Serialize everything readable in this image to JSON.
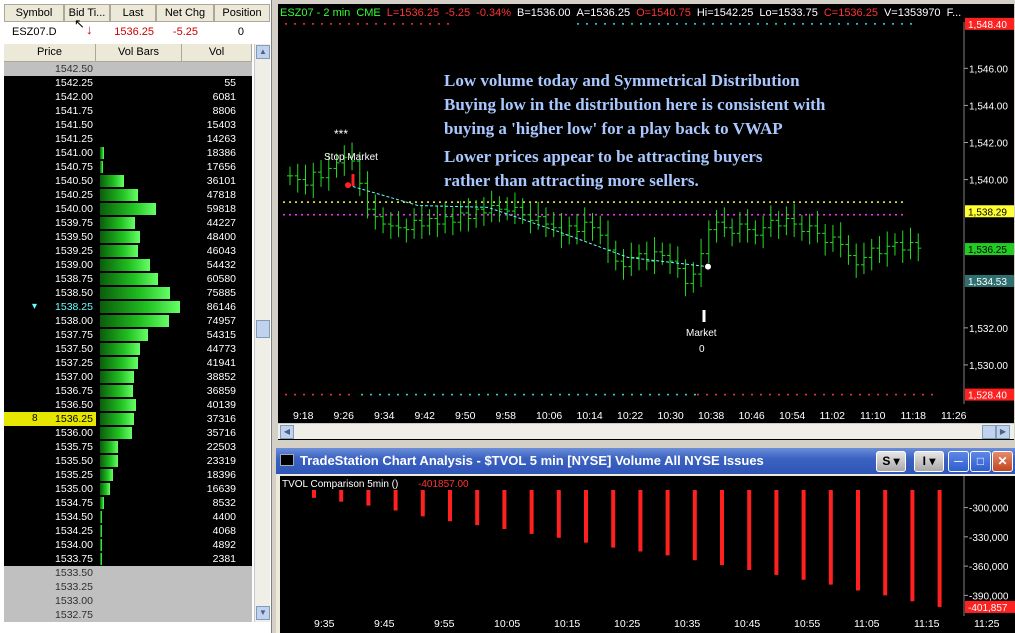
{
  "quote": {
    "headers": [
      "Symbol",
      "Bid Ti...",
      "Last",
      "Net Chg",
      "Position"
    ],
    "symbol": "ESZ07.D",
    "last": "1536.25",
    "net_chg": "-5.25",
    "position": "0"
  },
  "matrix": {
    "headers": [
      "Price",
      "Vol Bars",
      "Vol"
    ],
    "rows": [
      {
        "price": "1542.50",
        "vol": "",
        "bar": 0,
        "kind": "gray"
      },
      {
        "price": "1542.25",
        "vol": "55",
        "bar": 0.0
      },
      {
        "price": "1542.00",
        "vol": "6081",
        "bar": 0.0
      },
      {
        "price": "1541.75",
        "vol": "8806",
        "bar": 0.0
      },
      {
        "price": "1541.50",
        "vol": "15403",
        "bar": 0.0
      },
      {
        "price": "1541.25",
        "vol": "14263",
        "bar": 0.0
      },
      {
        "price": "1541.00",
        "vol": "18386",
        "bar": 0.05
      },
      {
        "price": "1540.75",
        "vol": "17656",
        "bar": 0.04
      },
      {
        "price": "1540.50",
        "vol": "36101",
        "bar": 0.3
      },
      {
        "price": "1540.25",
        "vol": "47818",
        "bar": 0.48
      },
      {
        "price": "1540.00",
        "vol": "59818",
        "bar": 0.7
      },
      {
        "price": "1539.75",
        "vol": "44227",
        "bar": 0.44
      },
      {
        "price": "1539.50",
        "vol": "48400",
        "bar": 0.5
      },
      {
        "price": "1539.25",
        "vol": "46043",
        "bar": 0.47
      },
      {
        "price": "1539.00",
        "vol": "54432",
        "bar": 0.62
      },
      {
        "price": "1538.75",
        "vol": "60580",
        "bar": 0.72
      },
      {
        "price": "1538.50",
        "vol": "75885",
        "bar": 0.88
      },
      {
        "price": "1538.25",
        "vol": "86146",
        "bar": 1.0,
        "kind": "current"
      },
      {
        "price": "1538.00",
        "vol": "74957",
        "bar": 0.86
      },
      {
        "price": "1537.75",
        "vol": "54315",
        "bar": 0.6
      },
      {
        "price": "1537.50",
        "vol": "44773",
        "bar": 0.5
      },
      {
        "price": "1537.25",
        "vol": "41941",
        "bar": 0.47
      },
      {
        "price": "1537.00",
        "vol": "38852",
        "bar": 0.43
      },
      {
        "price": "1536.75",
        "vol": "36859",
        "bar": 0.41
      },
      {
        "price": "1536.50",
        "vol": "40139",
        "bar": 0.45
      },
      {
        "price": "1536.25",
        "vol": "37316",
        "bar": 0.42,
        "kind": "last",
        "flag": "8"
      },
      {
        "price": "1536.00",
        "vol": "35716",
        "bar": 0.4
      },
      {
        "price": "1535.75",
        "vol": "22503",
        "bar": 0.22
      },
      {
        "price": "1535.50",
        "vol": "23319",
        "bar": 0.23
      },
      {
        "price": "1535.25",
        "vol": "18396",
        "bar": 0.16
      },
      {
        "price": "1535.00",
        "vol": "16639",
        "bar": 0.13
      },
      {
        "price": "1534.75",
        "vol": "8532",
        "bar": 0.05
      },
      {
        "price": "1534.50",
        "vol": "4400",
        "bar": 0.03
      },
      {
        "price": "1534.25",
        "vol": "4068",
        "bar": 0.03
      },
      {
        "price": "1534.00",
        "vol": "4892",
        "bar": 0.03
      },
      {
        "price": "1533.75",
        "vol": "2381",
        "bar": 0.02
      },
      {
        "price": "1533.50",
        "vol": "",
        "bar": 0,
        "kind": "gray"
      },
      {
        "price": "1533.25",
        "vol": "",
        "bar": 0,
        "kind": "gray"
      },
      {
        "price": "1533.00",
        "vol": "",
        "bar": 0,
        "kind": "gray"
      },
      {
        "price": "1532.75",
        "vol": "",
        "bar": 0,
        "kind": "gray"
      }
    ]
  },
  "upper_chart": {
    "title_parts": [
      {
        "text": "ESZ07 - 2 min",
        "color": "#33ff33"
      },
      {
        "text": "CME",
        "color": "#33ff33"
      },
      {
        "text": "L=1536.25",
        "color": "#ff3333"
      },
      {
        "text": "-5.25",
        "color": "#ff3333"
      },
      {
        "text": "-0.34%",
        "color": "#ff3333"
      },
      {
        "text": "B=1536.00",
        "color": "#ffffff"
      },
      {
        "text": "A=1536.25",
        "color": "#ffffff"
      },
      {
        "text": "O=1540.75",
        "color": "#ff3333"
      },
      {
        "text": "Hi=1542.25",
        "color": "#ffffff"
      },
      {
        "text": "Lo=1533.75",
        "color": "#ffffff"
      },
      {
        "text": "C=1536.25",
        "color": "#ff3333"
      },
      {
        "text": "V=1353970",
        "color": "#ffffff"
      },
      {
        "text": "F...",
        "color": "#ffffff"
      }
    ],
    "annotation_lines": [
      "Low volume today and Symmetrical Distribution",
      "Buying low in the distribution here is consistent with",
      "buying a 'higher low' for a play back to VWAP",
      "Lower prices appear to be attracting buyers",
      "rather than attracting more sellers."
    ],
    "stop_label": "Stop Market",
    "stars": "***",
    "market_label": "Market",
    "market_qty": "0",
    "y_ticks": [
      "1,546.00",
      "1,544.00",
      "1,542.00",
      "1,540.00",
      "1,532.00",
      "1,530.00"
    ],
    "price_tags": [
      {
        "text": "1,548.40",
        "price": 1548.4,
        "bg": "#ff2020",
        "fg": "#ffffff"
      },
      {
        "text": "1,538.29",
        "price": 1538.29,
        "bg": "#ffff33",
        "fg": "#000000"
      },
      {
        "text": "1,536.25",
        "price": 1536.25,
        "bg": "#22cc22",
        "fg": "#000000"
      },
      {
        "text": "1,534.53",
        "price": 1534.53,
        "bg": "#2f6f6f",
        "fg": "#ffffff"
      },
      {
        "text": "1,528.40",
        "price": 1528.4,
        "bg": "#ff2020",
        "fg": "#ffffff"
      }
    ],
    "x_ticks": [
      "9:18",
      "9:26",
      "9:34",
      "9:42",
      "9:50",
      "9:58",
      "10:06",
      "10:14",
      "10:22",
      "10:30",
      "10:38",
      "10:46",
      "10:54",
      "11:02",
      "11:10",
      "11:18",
      "11:26"
    ],
    "colors": {
      "bars": "#22dd22",
      "vwap": "#66ffff",
      "yellow_line": "#ffff33",
      "magenta_line": "#ff33ff",
      "band_red": "#ff3333",
      "band_cyan": "#33dddd",
      "annotation": "#a8c8ff"
    },
    "chart_data": {
      "type": "ohlc",
      "ylim": [
        1528,
        1548.5
      ],
      "closes": [
        1540.2,
        1540.0,
        1539.7,
        1540.4,
        1540.1,
        1540.6,
        1540.9,
        1541.2,
        1541.0,
        1539.8,
        1538.4,
        1538.0,
        1537.6,
        1537.5,
        1537.4,
        1537.3,
        1537.8,
        1537.5,
        1537.9,
        1537.6,
        1538.0,
        1537.7,
        1538.2,
        1537.9,
        1538.4,
        1538.2,
        1538.6,
        1538.4,
        1538.3,
        1538.5,
        1538.1,
        1537.8,
        1538.0,
        1537.6,
        1537.4,
        1537.0,
        1537.5,
        1537.2,
        1537.7,
        1537.4,
        1537.0,
        1536.2,
        1535.6,
        1535.3,
        1535.8,
        1536.0,
        1535.6,
        1536.1,
        1535.9,
        1535.6,
        1535.2,
        1534.4,
        1534.9,
        1536.0,
        1537.3,
        1537.7,
        1537.4,
        1537.1,
        1537.6,
        1537.3,
        1537.0,
        1537.4,
        1537.8,
        1537.5,
        1537.9,
        1537.6,
        1537.2,
        1537.5,
        1537.1,
        1536.6,
        1536.9,
        1536.5,
        1535.9,
        1535.4,
        1535.8,
        1536.3,
        1536.0,
        1536.4,
        1536.6,
        1536.2,
        1536.6,
        1536.3
      ]
    }
  },
  "lower_window": {
    "title": "TradeStation Chart Analysis - $TVOL  5 min  [NYSE] Volume All NYSE Issues",
    "btn_s": "S",
    "btn_i": "I",
    "legend": "TVOL Comparison 5min  ()",
    "legend_value": "-401857.00",
    "y_ticks": [
      "-300,000",
      "-330,000",
      "-360,000",
      "-390,000"
    ],
    "last_tag": "-401,857",
    "x_ticks": [
      "9:35",
      "9:45",
      "9:55",
      "10:05",
      "10:15",
      "10:25",
      "10:35",
      "10:45",
      "10:55",
      "11:05",
      "11:15",
      "11:25"
    ],
    "chart_data": {
      "type": "bar",
      "ylim": [
        -405000,
        -282000
      ],
      "values": [
        -290000,
        -294000,
        -298000,
        -303000,
        -309000,
        -314000,
        -318000,
        -322000,
        -327000,
        -331000,
        -336000,
        -341000,
        -345000,
        -349000,
        -354000,
        -359000,
        -364000,
        -369000,
        -374000,
        -379000,
        -385000,
        -390000,
        -396000,
        -401857
      ]
    }
  }
}
